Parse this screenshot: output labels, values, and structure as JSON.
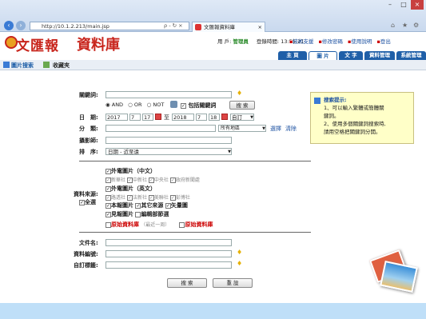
{
  "browser": {
    "url": "http://10.1.2.213/main.jsp",
    "tab_title": "文匯報資料庫",
    "search_hint": "ρ - ↻ ×"
  },
  "header": {
    "logo_text": "文匯報",
    "logo_text2": "資料庫",
    "user_label": "用 戶:",
    "user_name": "管理員",
    "login_time_label": "登錄時間:",
    "login_time": "13:55:21",
    "links": [
      "技術支援",
      "修改密碼",
      "使用說明",
      "登出"
    ],
    "tabs": [
      "主 頁",
      "圖 片",
      "文 字",
      "資料管理",
      "系統管理"
    ]
  },
  "subnav": {
    "items": [
      "圖片搜索",
      "收藏夾"
    ]
  },
  "form": {
    "keyword_label": "關鍵詞:",
    "keyword_value": "",
    "logic_options": [
      "AND",
      "OR",
      "NOT"
    ],
    "include_keyword": "包括關鍵詞",
    "search_btn": "搜 索",
    "date_label": "日　期:",
    "date_from": {
      "y": "2017",
      "m": "7",
      "d": "17"
    },
    "date_to_label": "至",
    "date_to": {
      "y": "2018",
      "m": "7",
      "d": "18"
    },
    "date_mode": "自訂",
    "category_label": "分　類:",
    "category_value": "所有地區",
    "choose_link": "選擇",
    "clear_link": "清除",
    "photographer_label": "攝影師:",
    "sort_label": "排　序:",
    "sort_value": "日期 - 近至遠",
    "source_label": "資料來源:",
    "select_all": "全選",
    "sources": {
      "tele_cn": "外電圖片（中文）",
      "tele_cn_items": [
        "新華社",
        "中新社",
        "中央社",
        "政府新聞處"
      ],
      "tele_en": "外電圖片（英文）",
      "tele_en_items": [
        "路透社",
        "法新社",
        "美聯社",
        "彭博社"
      ],
      "row3": [
        "本報圖片",
        "其它來源",
        "矢量圖"
      ],
      "row4": [
        "見報圖片",
        "編輯部節選"
      ],
      "original_db": "原始資料庫",
      "original_db_note": "（最近一周）",
      "original_db2": "原始資料庫"
    },
    "filename_label": "文件名:",
    "data_editor_label": "資料編號:",
    "custom_label": "自訂標籤:",
    "bottom_search": "搜 索",
    "reset": "重 設"
  },
  "tip": {
    "title": "搜索提示:",
    "lines": [
      "1、可以輸入繁體或簡體關",
      "鍵詞。",
      "2、使用多個關鍵詞搜索時,",
      "請用空格把關鍵詞分開。"
    ]
  }
}
